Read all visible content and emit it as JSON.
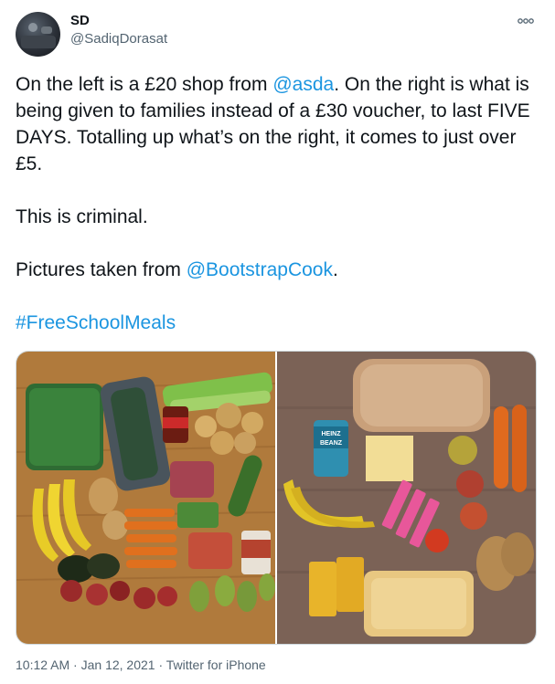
{
  "user": {
    "display_name": "SD",
    "handle": "@SadiqDorasat"
  },
  "tweet": {
    "line1_a": "On the left is a £20 shop from ",
    "line1_mention": "@asda",
    "line1_b": ". On the right is what is being given to families instead of a £30 voucher, to last FIVE DAYS. Totalling up what’s on the right, it comes to just over £5.",
    "line2": "This is criminal.",
    "line3_a": "Pictures taken from ",
    "line3_mention": "@BootstrapCook",
    "line3_b": ".",
    "hashtag": "#FreeSchoolMeals"
  },
  "media": {
    "left_label_heinz": "HEINZ",
    "left_label_beanz": "BEANZ"
  },
  "meta": {
    "time": "10:12 AM",
    "sep1": " · ",
    "date": "Jan 12, 2021",
    "sep2": " · ",
    "source": "Twitter for iPhone"
  },
  "icons": {
    "more": "more-options-icon"
  },
  "colors": {
    "link": "#1b95e0",
    "secondary_text": "#536471",
    "primary_text": "#0f1419"
  }
}
